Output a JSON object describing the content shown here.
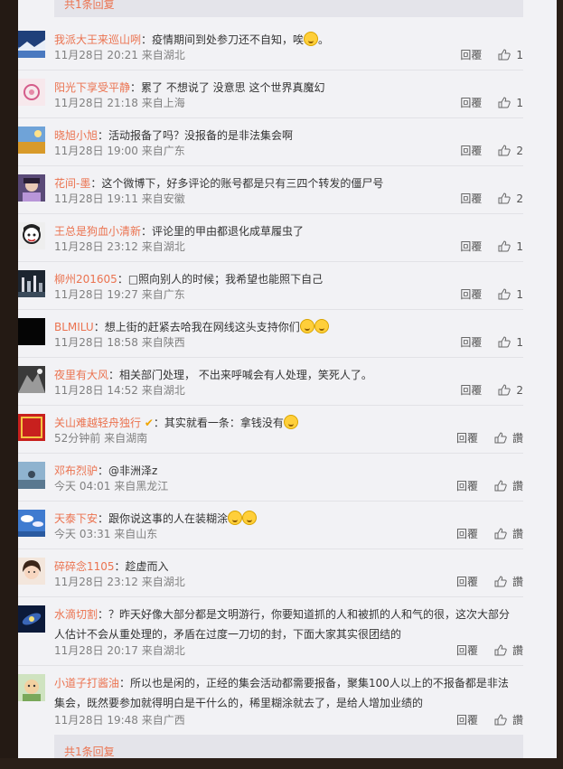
{
  "reply_bar_top": "共1条回复",
  "reply_bar_bottom": "共1条回复",
  "comments": [
    {
      "user": "我派大王来巡山咧",
      "content": "：疫情期间到处参刀还不自知，唉",
      "emoji": "smile-emoji",
      "suffix": "。",
      "time": "11月28日 20:21",
      "location": "来自湖北",
      "reply": "回覆",
      "likes": "1"
    },
    {
      "user": "阳光下享受平静",
      "content": "：累了 不想说了 没意思 这个世界真魔幻",
      "time": "11月28日 21:18",
      "location": "来自上海",
      "reply": "回覆",
      "likes": "1"
    },
    {
      "user": "晓旭小旭",
      "content": "：活动报备了吗？没报备的是非法集会啊",
      "time": "11月28日 19:00",
      "location": "来自广东",
      "reply": "回覆",
      "likes": "2"
    },
    {
      "user": "花间-墨",
      "content": "：这个微博下，好多评论的账号都是只有三四个转发的僵尸号",
      "time": "11月28日 19:11",
      "location": "来自安徽",
      "reply": "回覆",
      "likes": "2"
    },
    {
      "user": "王总是狗血小清新",
      "content": "：评论里的甲由都退化成草履虫了",
      "time": "11月28日 23:12",
      "location": "来自湖北",
      "reply": "回覆",
      "likes": "1"
    },
    {
      "user": "柳州201605",
      "content": "：□照向别人的时候；我希望也能照下自己",
      "time": "11月28日 19:27",
      "location": "来自广东",
      "reply": "回覆",
      "likes": "1"
    },
    {
      "user": "BLMILU",
      "content": "：想上街的赶紧去哈我在网线这头支持你们",
      "time": "11月28日 18:58",
      "location": "来自陕西",
      "reply": "回覆",
      "likes": "1"
    },
    {
      "user": "夜里有大风",
      "content": "：相关部门处理， 不出来呼喊会有人处理，笑死人了。",
      "time": "11月28日 14:52",
      "location": "来自湖北",
      "reply": "回覆",
      "likes": "2"
    },
    {
      "user": "关山难越轻舟独行",
      "content": "：其实就看一条：拿钱没有",
      "time": "52分钟前",
      "location": "来自湖南",
      "reply": "回覆",
      "likes": "讚"
    },
    {
      "user": "邓布烈驴",
      "content": "：@非洲泽z",
      "time": "今天 04:01",
      "location": "来自黑龙江",
      "reply": "回覆",
      "likes": "讚"
    },
    {
      "user": "天泰下安",
      "content": "：跟你说这事的人在装糊涂",
      "time": "今天 03:31",
      "location": "来自山东",
      "reply": "回覆",
      "likes": "讚"
    },
    {
      "user": "碎碎念1105",
      "content": "：趁虚而入",
      "time": "11月28日 23:12",
      "location": "来自湖北",
      "reply": "回覆",
      "likes": "讚"
    },
    {
      "user": "水滴切割",
      "content": "：？昨天好像大部分都是文明游行，你要知道抓的人和被抓的人和气的很，这次大部分人估计不会从重处理的，矛盾在过度一刀切的封，下面大家其实很团结的",
      "time": "11月28日 20:17",
      "location": "来自湖北",
      "reply": "回覆",
      "likes": "讚"
    },
    {
      "user": "小道子打酱油",
      "content": "：所以也是闲的，正经的集会活动都需要报备，聚集100人以上的不报备都是非法集会，既然要参加就得明白是干什么的，稀里糊涂就去了，是给人增加业绩的",
      "time": "11月28日 19:48",
      "location": "来自广西",
      "reply": "回覆",
      "likes": "讚"
    }
  ],
  "colors": {
    "username": "#eb7350",
    "panel": "#f2f2f5",
    "meta": "#808080"
  }
}
